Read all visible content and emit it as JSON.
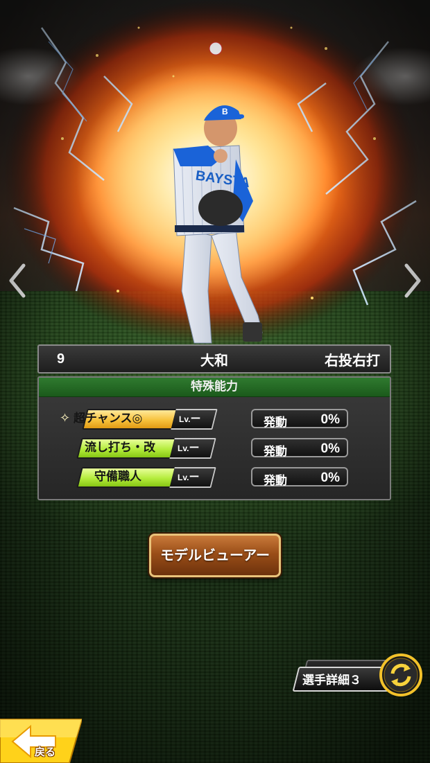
{
  "player": {
    "number": "9",
    "name": "大和",
    "throw_bat": "右投右打",
    "uniform_text": "BAYSTARS"
  },
  "abilities": {
    "header": "特殊能力",
    "items": [
      {
        "prefix": "超",
        "label": "チャンス◎",
        "level": "Lv.",
        "level_value": "ー",
        "activate_label": "発動",
        "activate_value": "0%",
        "badge": "gold"
      },
      {
        "prefix": "",
        "label": "流し打ち・改",
        "level": "Lv.",
        "level_value": "ー",
        "activate_label": "発動",
        "activate_value": "0%",
        "badge": "green"
      },
      {
        "prefix": "",
        "label": "守備職人",
        "level": "Lv.",
        "level_value": "ー",
        "activate_label": "発動",
        "activate_value": "0%",
        "badge": "green"
      }
    ]
  },
  "buttons": {
    "model_viewer": "モデルビューアー",
    "player_detail": "選手詳細３",
    "back": "戻る"
  },
  "colors": {
    "header_green": "#2f7a2f",
    "badge_gold": "#f7c23c",
    "badge_green": "#b4ec3c",
    "model_button_brown": "#9a4e18",
    "back_button_yellow": "#ffd21a"
  },
  "icons": {
    "nav_prev": "chevron-left-icon",
    "nav_next": "chevron-right-icon",
    "detail_cycle": "cycle-arrows-icon",
    "back": "back-arrow-icon",
    "sparkle": "sparkle-icon"
  }
}
